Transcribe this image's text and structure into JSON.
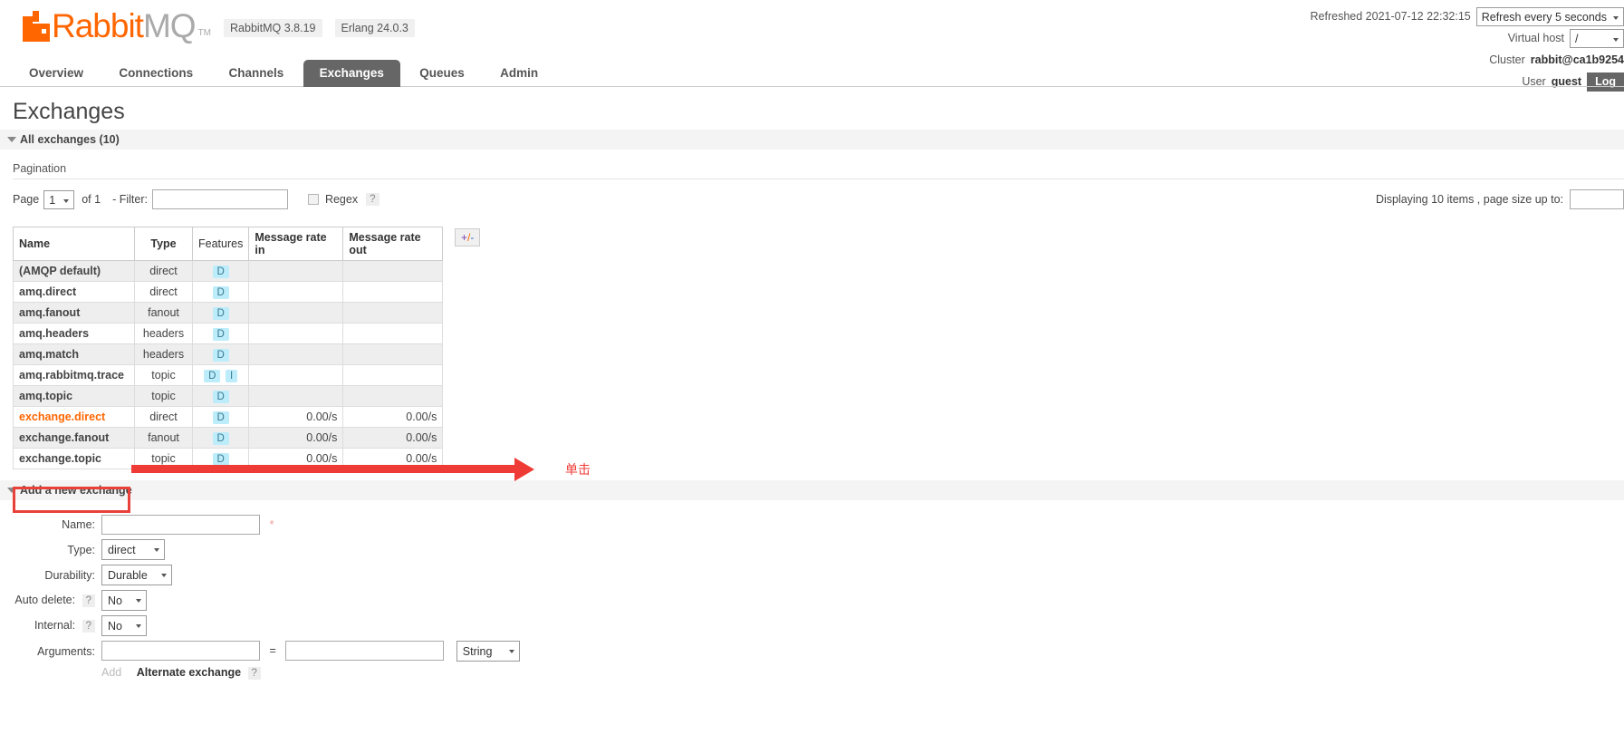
{
  "brand": {
    "name_rabbit": "Rabbit",
    "name_mq": "MQ",
    "tm": "TM",
    "version_rabbitmq": "RabbitMQ 3.8.19",
    "version_erlang": "Erlang 24.0.3"
  },
  "status": {
    "refreshed_label": "Refreshed 2021-07-12 22:32:15",
    "refresh_interval": "Refresh every 5 seconds",
    "vhost_label": "Virtual host",
    "vhost_value": "/",
    "cluster_label": "Cluster",
    "cluster_value": "rabbit@ca1b9254",
    "user_label": "User",
    "user_value": "guest",
    "logout_label": "Log"
  },
  "tabs": [
    {
      "label": "Overview",
      "active": false
    },
    {
      "label": "Connections",
      "active": false
    },
    {
      "label": "Channels",
      "active": false
    },
    {
      "label": "Exchanges",
      "active": true
    },
    {
      "label": "Queues",
      "active": false
    },
    {
      "label": "Admin",
      "active": false
    }
  ],
  "page": {
    "title": "Exchanges",
    "all_exchanges_label": "All exchanges (10)",
    "pagination_label": "Pagination"
  },
  "pagination": {
    "page_label": "Page",
    "page_value": "1",
    "of_label": "of 1",
    "filter_label": "- Filter:",
    "filter_value": "",
    "regex_label": "Regex",
    "help_mark": "?",
    "displaying_label": "Displaying 10 items , page size up to:",
    "page_size_value": ""
  },
  "table": {
    "columns": [
      "Name",
      "Type",
      "Features",
      "Message rate in",
      "Message rate out"
    ],
    "plusminus_plus": "+",
    "plusminus_slash": "/",
    "plusminus_minus": "-",
    "rows": [
      {
        "name": "(AMQP default)",
        "type": "direct",
        "features": [
          "D"
        ],
        "rate_in": "",
        "rate_out": "",
        "link": false
      },
      {
        "name": "amq.direct",
        "type": "direct",
        "features": [
          "D"
        ],
        "rate_in": "",
        "rate_out": "",
        "link": false
      },
      {
        "name": "amq.fanout",
        "type": "fanout",
        "features": [
          "D"
        ],
        "rate_in": "",
        "rate_out": "",
        "link": false
      },
      {
        "name": "amq.headers",
        "type": "headers",
        "features": [
          "D"
        ],
        "rate_in": "",
        "rate_out": "",
        "link": false
      },
      {
        "name": "amq.match",
        "type": "headers",
        "features": [
          "D"
        ],
        "rate_in": "",
        "rate_out": "",
        "link": false
      },
      {
        "name": "amq.rabbitmq.trace",
        "type": "topic",
        "features": [
          "D",
          "I"
        ],
        "rate_in": "",
        "rate_out": "",
        "link": false
      },
      {
        "name": "amq.topic",
        "type": "topic",
        "features": [
          "D"
        ],
        "rate_in": "",
        "rate_out": "",
        "link": false
      },
      {
        "name": "exchange.direct",
        "type": "direct",
        "features": [
          "D"
        ],
        "rate_in": "0.00/s",
        "rate_out": "0.00/s",
        "link": true
      },
      {
        "name": "exchange.fanout",
        "type": "fanout",
        "features": [
          "D"
        ],
        "rate_in": "0.00/s",
        "rate_out": "0.00/s",
        "link": false
      },
      {
        "name": "exchange.topic",
        "type": "topic",
        "features": [
          "D"
        ],
        "rate_in": "0.00/s",
        "rate_out": "0.00/s",
        "link": false
      }
    ]
  },
  "annotation": {
    "text": "单击",
    "color": "#ef3b36"
  },
  "form": {
    "section_title": "Add a new exchange",
    "name_label": "Name:",
    "name_value": "",
    "required_mark": "*",
    "type_label": "Type:",
    "type_value": "direct",
    "durability_label": "Durability:",
    "durability_value": "Durable",
    "auto_delete_label": "Auto delete:",
    "auto_delete_value": "No",
    "internal_label": "Internal:",
    "internal_value": "No",
    "arguments_label": "Arguments:",
    "arg_key_value": "",
    "arg_val_value": "",
    "arg_type_value": "String",
    "equals": "=",
    "add_label": "Add",
    "alternate_exchange_label": "Alternate exchange",
    "help_mark": "?"
  }
}
